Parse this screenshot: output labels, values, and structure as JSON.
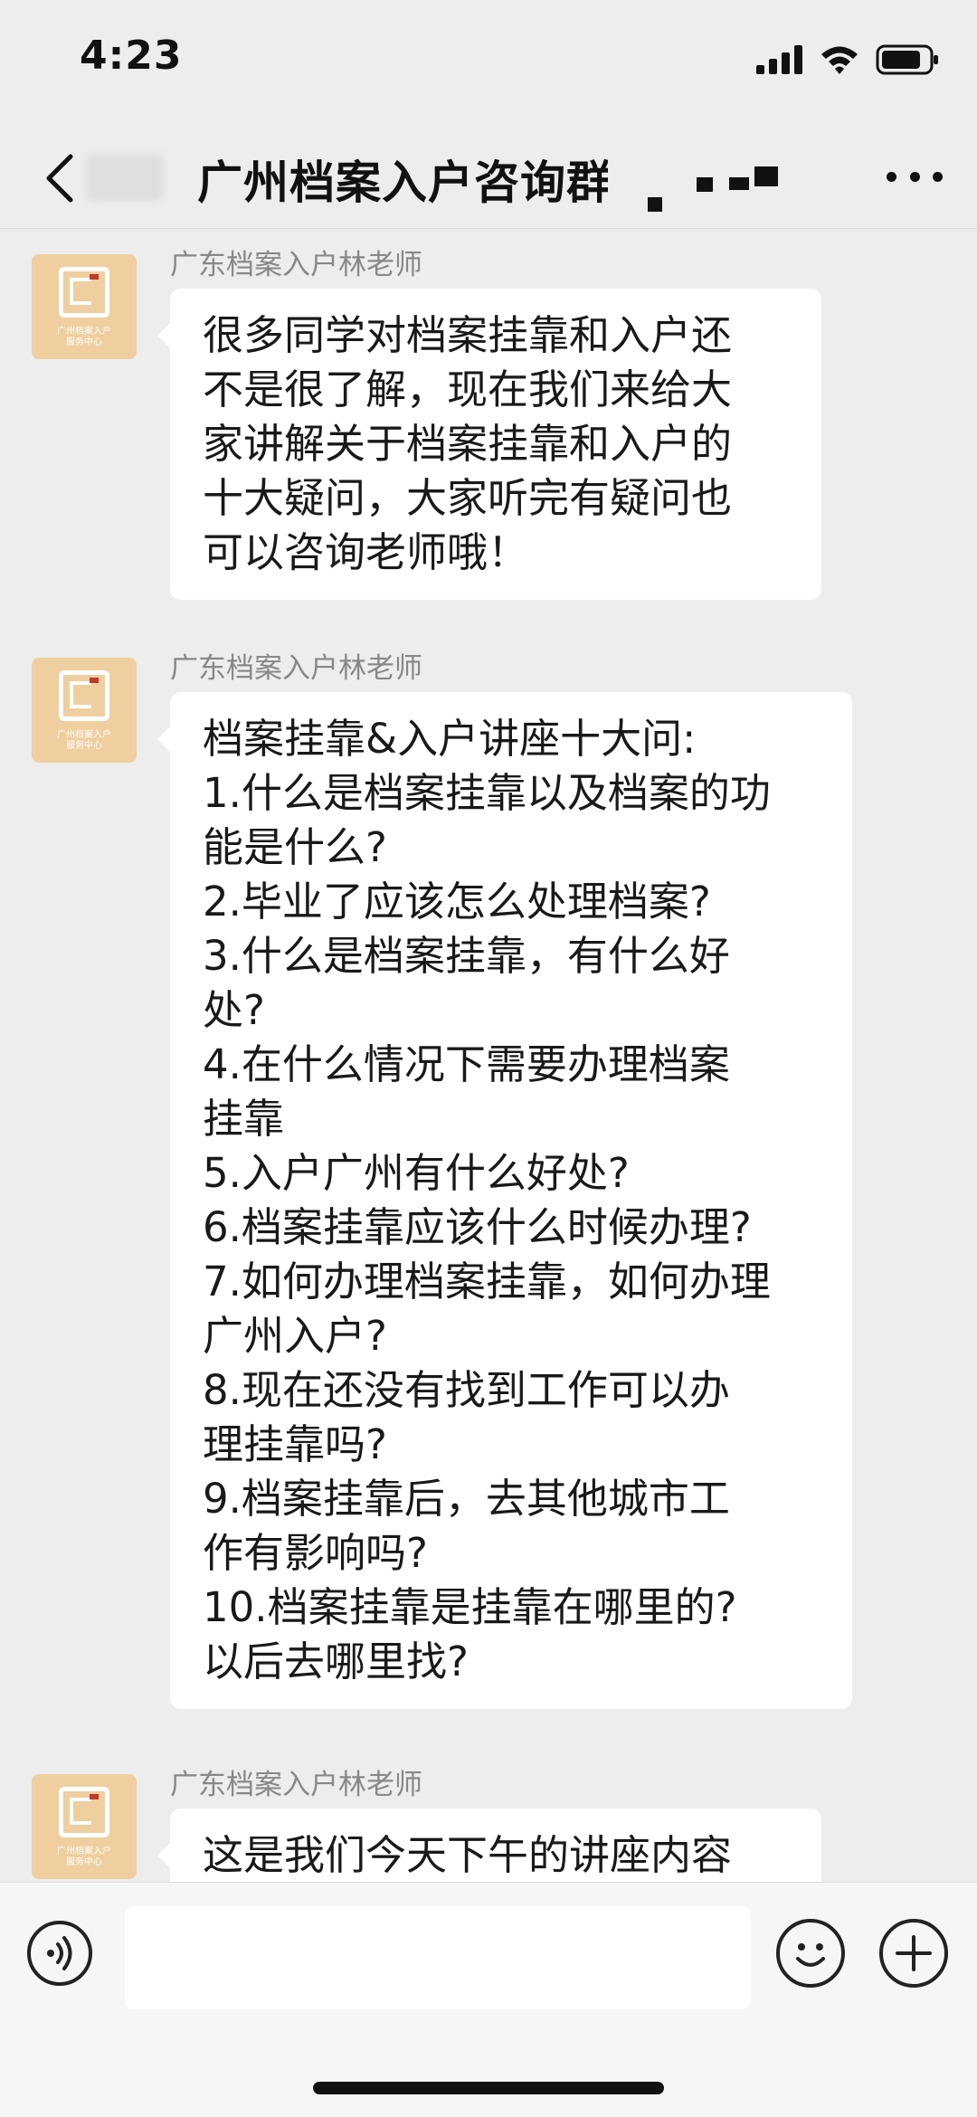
{
  "status_bar": {
    "time": "4:23"
  },
  "nav": {
    "title": "广州档案入户咨询群"
  },
  "messages": [
    {
      "sender": "广东档案入户林老师",
      "lines": [
        "很多同学对档案挂靠和入户还",
        "不是很了解，现在我们来给大",
        "家讲解关于档案挂靠和入户的",
        "十大疑问，大家听完有疑问也",
        "可以咨询老师哦！"
      ]
    },
    {
      "sender": "广东档案入户林老师",
      "lines": [
        "档案挂靠&入户讲座十大问:",
        "1.什么是档案挂靠以及档案的功",
        "能是什么?",
        "2.毕业了应该怎么处理档案?",
        "3.什么是档案挂靠，有什么好",
        "处?",
        "4.在什么情况下需要办理档案",
        "挂靠",
        "5.入户广州有什么好处?",
        "6.档案挂靠应该什么时候办理?",
        "7.如何办理档案挂靠，如何办理",
        "广州入户?",
        "8.现在还没有找到工作可以办",
        "理挂靠吗?",
        "9.档案挂靠后，去其他城市工",
        "作有影响吗?",
        "10.档案挂靠是挂靠在哪里的?",
        "以后去哪里找?"
      ]
    },
    {
      "sender": "广东档案入户林老师",
      "lines": [
        "这是我们今天下午的讲座内容"
      ]
    }
  ],
  "avatar_logo_text": [
    "广州档案入户",
    "服务中心"
  ],
  "input": {
    "placeholder": ""
  },
  "icons": {
    "back": "chevron-left-icon",
    "more": "more-dots-icon",
    "voice": "voice-icon",
    "emoji": "emoji-icon",
    "plus": "plus-icon"
  },
  "colors": {
    "background": "#ededed",
    "bubble": "#ffffff",
    "avatar": "#efcf9f",
    "sender": "#888888"
  }
}
